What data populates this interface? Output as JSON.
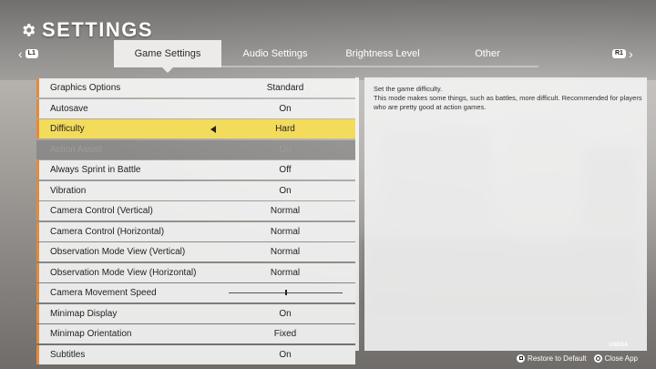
{
  "header": {
    "title": "SETTINGS",
    "icon": "gear-icon"
  },
  "tabs": {
    "prev_button": "L1",
    "next_button": "R1",
    "items": [
      {
        "label": "Game Settings",
        "active": true
      },
      {
        "label": "Audio Settings",
        "active": false
      },
      {
        "label": "Brightness Level",
        "active": false
      },
      {
        "label": "Other",
        "active": false
      }
    ]
  },
  "settings": [
    {
      "label": "Graphics Options",
      "value": "Standard"
    },
    {
      "label": "Autosave",
      "value": "On"
    },
    {
      "label": "Difficulty",
      "value": "Hard",
      "selected": true
    },
    {
      "label": "Action Assist",
      "value": "On",
      "disabled": true
    },
    {
      "label": "Always Sprint in Battle",
      "value": "Off"
    },
    {
      "label": "Vibration",
      "value": "On"
    },
    {
      "label": "Camera Control (Vertical)",
      "value": "Normal"
    },
    {
      "label": "Camera Control (Horizontal)",
      "value": "Normal"
    },
    {
      "label": "Observation Mode View (Vertical)",
      "value": "Normal"
    },
    {
      "label": "Observation Mode View (Horizontal)",
      "value": "Normal"
    },
    {
      "label": "Camera Movement Speed",
      "value": "",
      "slider_level": 0.5
    },
    {
      "label": "Minimap Display",
      "value": "On"
    },
    {
      "label": "Minimap Orientation",
      "value": "Fixed"
    },
    {
      "label": "Subtitles",
      "value": "On"
    }
  ],
  "description": {
    "line1": "Set the game difficulty.",
    "line2": "This mode makes some things, such as battles, more difficult. Recommended for players who are pretty good at action games."
  },
  "footer": {
    "copyright": "©SEGA",
    "restore_label": "Restore to Default",
    "close_label": "Close App"
  },
  "colors": {
    "accent": "#e38b3c",
    "selected_row": "#f3dc5c"
  }
}
